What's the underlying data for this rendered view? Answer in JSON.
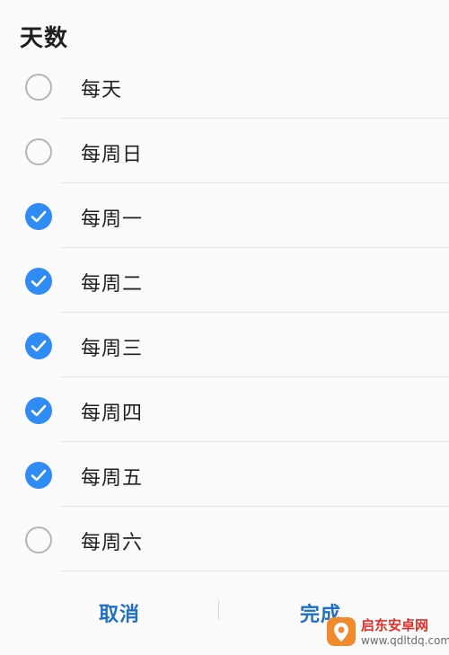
{
  "dialog": {
    "title": "天数",
    "items": [
      {
        "label": "每天",
        "checked": false
      },
      {
        "label": "每周日",
        "checked": false
      },
      {
        "label": "每周一",
        "checked": true
      },
      {
        "label": "每周二",
        "checked": true
      },
      {
        "label": "每周三",
        "checked": true
      },
      {
        "label": "每周四",
        "checked": true
      },
      {
        "label": "每周五",
        "checked": true
      },
      {
        "label": "每周六",
        "checked": false
      }
    ],
    "cancel_label": "取消",
    "done_label": "完成"
  },
  "watermark": {
    "name": "启东安卓网",
    "url": "www.qdltdq.com"
  },
  "colors": {
    "accent": "#2f8cf5",
    "button_text": "#1f6fc9",
    "watermark_red": "#e0312c",
    "watermark_orange": "#f08a2a"
  }
}
